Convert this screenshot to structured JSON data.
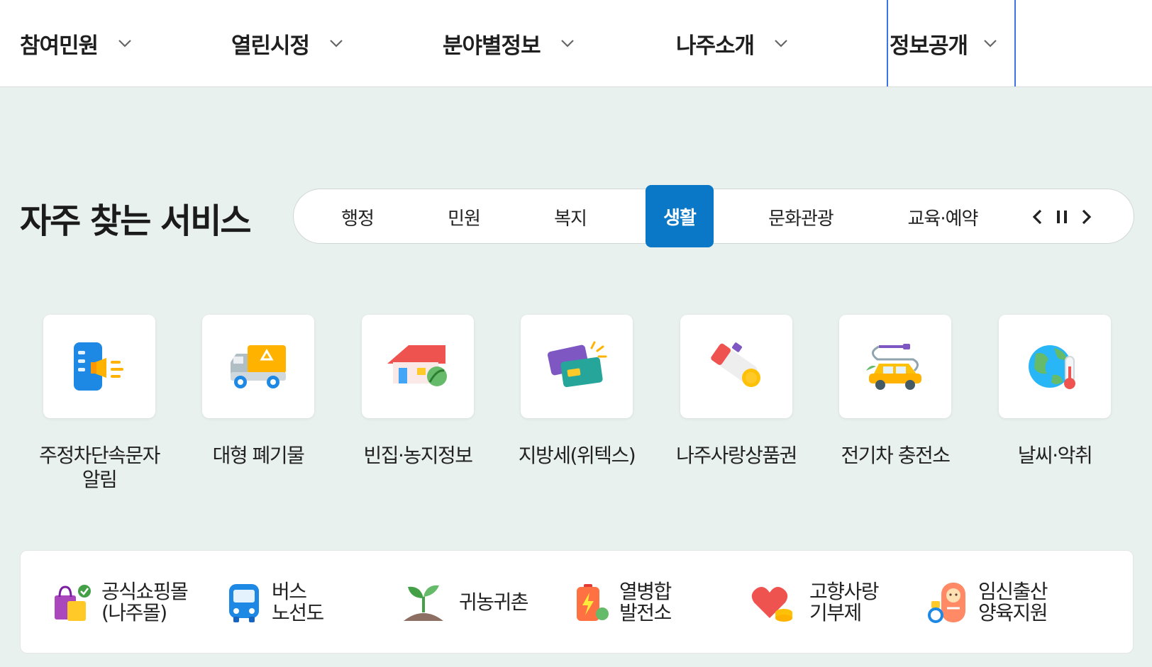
{
  "nav": {
    "items": [
      {
        "label": "참여민원"
      },
      {
        "label": "열린시정"
      },
      {
        "label": "분야별정보"
      },
      {
        "label": "나주소개"
      },
      {
        "label": "정보공개"
      }
    ]
  },
  "section": {
    "title": "자주 찾는 서비스",
    "tabs": [
      {
        "label": "행정"
      },
      {
        "label": "민원"
      },
      {
        "label": "복지"
      },
      {
        "label": "생활"
      },
      {
        "label": "문화관광"
      },
      {
        "label": "교육·예약"
      }
    ],
    "active_tab": "생활"
  },
  "services": [
    {
      "label": "주정차단속문자알림",
      "icon": "parking-alert-icon"
    },
    {
      "label": "대형 폐기물",
      "icon": "recycle-truck-icon"
    },
    {
      "label": "빈집·농지정보",
      "icon": "house-leaf-icon"
    },
    {
      "label": "지방세(위텍스)",
      "icon": "card-payment-icon"
    },
    {
      "label": "나주사랑상품권",
      "icon": "voucher-coin-icon"
    },
    {
      "label": "전기차 충전소",
      "icon": "ev-car-icon"
    },
    {
      "label": "날씨·악취",
      "icon": "globe-thermometer-icon"
    }
  ],
  "quick_links": [
    {
      "line1": "공식쇼핑몰",
      "line2": "(나주몰)",
      "icon": "shopping-bag-icon"
    },
    {
      "line1": "버스",
      "line2": "노선도",
      "icon": "bus-icon"
    },
    {
      "line1": "귀농귀촌",
      "line2": "",
      "icon": "sprout-icon"
    },
    {
      "line1": "열병합",
      "line2": "발전소",
      "icon": "battery-icon"
    },
    {
      "line1": "고향사랑",
      "line2": "기부제",
      "icon": "heart-coin-icon"
    },
    {
      "line1": "임신출산",
      "line2": "양육지원",
      "icon": "baby-icon"
    }
  ],
  "colors": {
    "accent": "#0a77c7",
    "background": "#e9f1ee",
    "focus_border": "#3b74e0"
  }
}
